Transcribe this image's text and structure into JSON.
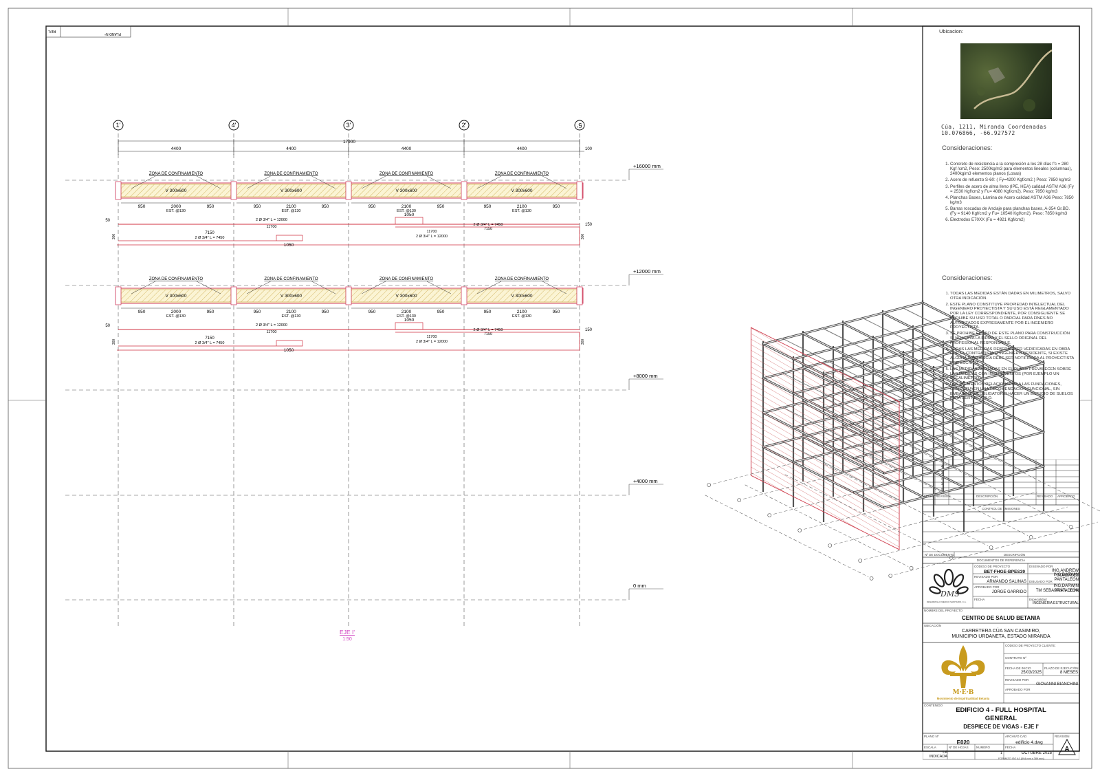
{
  "sheet": {
    "axes": [
      "1'",
      "4'",
      "3'",
      "2'",
      "5'"
    ],
    "total_dim": "17900",
    "span_dim": "4400",
    "end_dim": "100",
    "levels": [
      "+16000 mm",
      "+12000 mm",
      "+8000 mm",
      "+4000 mm",
      "0 mm"
    ],
    "beam_label": "V 300x600",
    "zona": "ZONA DE CONFINAMIENTO",
    "dim_950": "950",
    "dim_2000": "2000",
    "dim_2100": "2100",
    "est": "EST. @130",
    "dim_1050": "1050",
    "bar_12000": "2 Ø 3/4\" L = 12000",
    "dim_11700": "11700",
    "bar_7450": "2 Ø 3/4\" L = 7450",
    "dim_7150": "7150",
    "dim_50": "50",
    "dim_150": "150",
    "dim_300": "300",
    "view_title": "EJE I'",
    "view_scale": "1:50",
    "corner_plano": "PLANO Nº",
    "corner_rev": "REV."
  },
  "titleblock": {
    "ubicacion_label": "Ubicacion:",
    "location_text": "Cúa, 1211, Miranda Coordenadas 10.076866, -66.927572",
    "consideraciones_title": "Consideraciones:",
    "consideraciones_1": [
      "Concreto de resistencia a la compresión a los 28 días f'c = 280 Kgf /cm2, Peso: 2500kg/m3 para elementos lineales (columnas), 2400kg/m3 elementos planos (Losas)",
      "Acero de refuerzo S-60: ( Fy=4200 Kgf/cm2.) Peso: 7850 kg/m3",
      "Perfiles de acero de alma lleno (IPE, HEA) calidad ASTM A36 (Fy = 2530 Kgf/cm2 y Fu= 4080 Kgf/cm2). Peso: 7850 kg/m3",
      "Planchas Bases, Lámina de Acero calidad ASTM A36 Peso: 7850 kg/m3",
      "Barras roscadas de Anclaje para planchas bases, A-354 Gr.BD. (Fy = 9140 Kgf/cm2 y Fu= 10540 Kgf/cm2). Peso: 7850 kg/m3",
      "Electrodos E70XX (Fu = 4921 Kgf/cm2)"
    ],
    "consideraciones_2": [
      "TODAS LAS MEDIDAS ESTÁN DADAS EN MILIMETROS, SALVO OTRA INDICACIÓN.",
      "ESTE PLANO CONSTITUYE PROPIEDAD INTELECTUAL DEL INGENIERO PROYECTISTA Y SU USO ESTÁ REGLAMENTADO POR LA LEY CORRESPONDIENTE, POR CONSIGUIENTE SE PROHIBE SU USO TOTAL O PARCIAL PARA FINES NO AUTORIZADOS EXPRESAMENTE POR EL INGENIERO PROYECTISTA.",
      "SE PROHIBE EL USO DE ESTE PLANO PARA CONSTRUCCIÓN SI NO LLEVA LA FIRMA Y EL SELLO ORIGINAL DEL PROFESIONAL RESPONSABLE.",
      "TODAS LAS MEDIDAS DEBERÁN SER VERIFICADAS EN OBRA POR EL CONTRATISTA O INGENIERO RESIDENTE, SI EXISTE ALGUNA DIFERENCIA DEBE SER NOTIFICADA AL PROYECTISTA POR ESCRITO.",
      "LAS MEDIDAS ACOTADAS EN EL PLANO PREVALECEN SOBRE LAS MEDIDAS CON INSTRUMENTOS (POR EJEMPLO UN ESCALIMETRO).",
      "LOS ELEMENTOS RELACIONADOS A LAS FUNDACIONES, CONSTITUYEN UNA RECOMENDACION FUNCIONAL, SIN EMBARGO, ES OBLIGATORIO HACER UN ESTUDIO DE SUELOS PARA CERTIFICARLO."
    ],
    "rev_numbers": [
      "5",
      "4",
      "3",
      "2",
      "1",
      "0"
    ],
    "rev_headers": [
      "FECHA",
      "REVISIÓN",
      "DESCRIPCIÓN",
      "REVISADO",
      "APROBADO"
    ],
    "control_emisiones": "CONTROL DE EMISIONES",
    "doc_headers": [
      "Nº DE DOCUMENTO",
      "DESCRIPCIÓN"
    ],
    "docs_ref": "DOCUMENTOS DE REFERENCIA",
    "codigo_proyecto_label": "CÓDIGO DE PROYECTO",
    "codigo_proyecto": "BET-FHGE-BPES39",
    "disenado_label": "DISEÑADO POR",
    "disenado_1": "ING.ANDREW GONZÁLEZ",
    "disenado_2": "ING.DARWIN PANTALEÓN",
    "revisado_label": "REVISADO POR",
    "revisado": "ARMANDO SALINAS",
    "dibujado_label": "DIBUJADO POR",
    "dibujado_1": "ING.DARWIN PANTALEÓN",
    "dibujado_2": "TM SEBASTIÁN COVA",
    "aprobado_label": "APROBADO POR",
    "aprobado": "JORGE GARRIDO",
    "fecha_label": "FECHA",
    "especialidad_label": "Especialidad",
    "especialidad": "INGENIERIA ESTRUCTURAL",
    "dms_logo": "DMS",
    "dms_sub": "DESARROLLO MEDICO SANITARIO, C.A.",
    "nombre_label": "NOMBRE DEL PROYECTO",
    "nombre": "CENTRO DE SALUD BETANIA",
    "ubicacion2_label": "UBICACIÓN",
    "ubicacion_1": "CARRETERA CÚA SAN CASIMIRO,",
    "ubicacion_2": "MUNICIPIO URDANETA, ESTADO MIRANDA",
    "codigo_cliente_label": "CÓDIGO DE PROYECTO CLIENTE:",
    "contrato_label": "CONTRATO Nº",
    "fecha_inicio_label": "FECHA DE INICIO",
    "fecha_inicio": "25/03/2025",
    "plazo_label": "PLAZO DE EJECUCIÓN",
    "plazo": "8 MESES",
    "revisado2_label": "REVISADO POR",
    "revisado2": "GIOVANNI BIANCHINI",
    "aprobado2_label": "APROBADO POR",
    "meb_logo": "M·E·B",
    "meb_sub": "Movimiento de Espiritualidad Betania",
    "contenido_label": "CONTENIDO",
    "titulo_1": "EDIFICIO 4 - FULL HOSPITAL",
    "titulo_2": "GENERAL",
    "subtitulo": "DESPIECE DE VIGAS - EJE I'",
    "plano_label": "PLANO Nº",
    "plano": "E020",
    "archivo_label": "ARCHIVO CAD",
    "archivo": "edificio 4.dwg",
    "revision_label": "REVISIÓN",
    "revision": "A",
    "escala_label": "ESCALA",
    "escala": "LA INDICADA",
    "hojas_label": "Nº DE HOJAS",
    "numero_label": "NUMERO",
    "numero": "1",
    "fecha2_label": "FECHA",
    "fecha2": "OCTUBRE 2025",
    "formato": "FORMATO ISO A1 (594 mm x 389 mm)"
  }
}
